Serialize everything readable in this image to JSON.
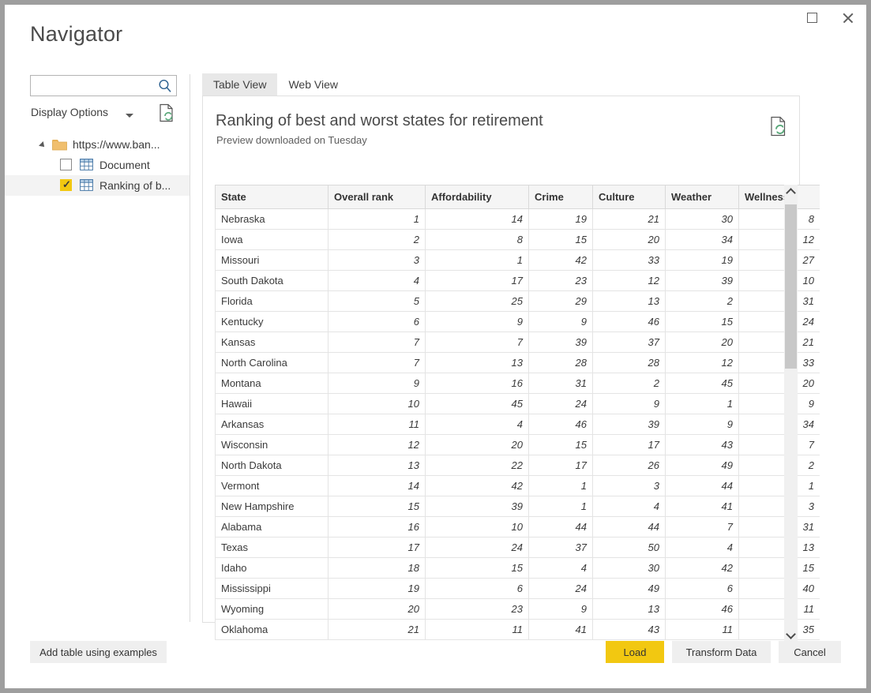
{
  "window": {
    "title": "Navigator",
    "controls": {
      "maximize": "maximize-button",
      "close": "close-button"
    }
  },
  "sidebar": {
    "search": {
      "value": "",
      "placeholder": ""
    },
    "display_options_label": "Display Options",
    "tree": {
      "root": {
        "label": "https://www.ban...",
        "expanded": true
      },
      "items": [
        {
          "label": "Document",
          "checked": false,
          "selected": false
        },
        {
          "label": "Ranking of b...",
          "checked": true,
          "selected": true
        }
      ]
    }
  },
  "main": {
    "tabs": [
      {
        "label": "Table View",
        "active": true
      },
      {
        "label": "Web View",
        "active": false
      }
    ],
    "preview_title": "Ranking of best and worst states for retirement",
    "preview_subtitle": "Preview downloaded on Tuesday",
    "refresh_icon": "refresh-document-icon"
  },
  "table_data": {
    "type": "table",
    "columns": [
      "State",
      "Overall rank",
      "Affordability",
      "Crime",
      "Culture",
      "Weather",
      "Wellness"
    ],
    "rows": [
      [
        "Nebraska",
        "1",
        "14",
        "19",
        "21",
        "30",
        "8"
      ],
      [
        "Iowa",
        "2",
        "8",
        "15",
        "20",
        "34",
        "12"
      ],
      [
        "Missouri",
        "3",
        "1",
        "42",
        "33",
        "19",
        "27"
      ],
      [
        "South Dakota",
        "4",
        "17",
        "23",
        "12",
        "39",
        "10"
      ],
      [
        "Florida",
        "5",
        "25",
        "29",
        "13",
        "2",
        "31"
      ],
      [
        "Kentucky",
        "6",
        "9",
        "9",
        "46",
        "15",
        "24"
      ],
      [
        "Kansas",
        "7",
        "7",
        "39",
        "37",
        "20",
        "21"
      ],
      [
        "North Carolina",
        "7",
        "13",
        "28",
        "28",
        "12",
        "33"
      ],
      [
        "Montana",
        "9",
        "16",
        "31",
        "2",
        "45",
        "20"
      ],
      [
        "Hawaii",
        "10",
        "45",
        "24",
        "9",
        "1",
        "9"
      ],
      [
        "Arkansas",
        "11",
        "4",
        "46",
        "39",
        "9",
        "34"
      ],
      [
        "Wisconsin",
        "12",
        "20",
        "15",
        "17",
        "43",
        "7"
      ],
      [
        "North Dakota",
        "13",
        "22",
        "17",
        "26",
        "49",
        "2"
      ],
      [
        "Vermont",
        "14",
        "42",
        "1",
        "3",
        "44",
        "1"
      ],
      [
        "New Hampshire",
        "15",
        "39",
        "1",
        "4",
        "41",
        "3"
      ],
      [
        "Alabama",
        "16",
        "10",
        "44",
        "44",
        "7",
        "31"
      ],
      [
        "Texas",
        "17",
        "24",
        "37",
        "50",
        "4",
        "13"
      ],
      [
        "Idaho",
        "18",
        "15",
        "4",
        "30",
        "42",
        "15"
      ],
      [
        "Mississippi",
        "19",
        "6",
        "24",
        "49",
        "6",
        "40"
      ],
      [
        "Wyoming",
        "20",
        "23",
        "9",
        "13",
        "46",
        "11"
      ],
      [
        "Oklahoma",
        "21",
        "11",
        "41",
        "43",
        "11",
        "35"
      ]
    ]
  },
  "footer": {
    "add_table_label": "Add table using examples",
    "load_label": "Load",
    "transform_label": "Transform Data",
    "cancel_label": "Cancel"
  },
  "colors": {
    "accent_yellow": "#f2c811",
    "window_border": "#9e9e9e",
    "tab_active_bg": "#e8e8e8",
    "header_bg": "#f5f5f5",
    "refresh_green": "#5aa87a"
  }
}
